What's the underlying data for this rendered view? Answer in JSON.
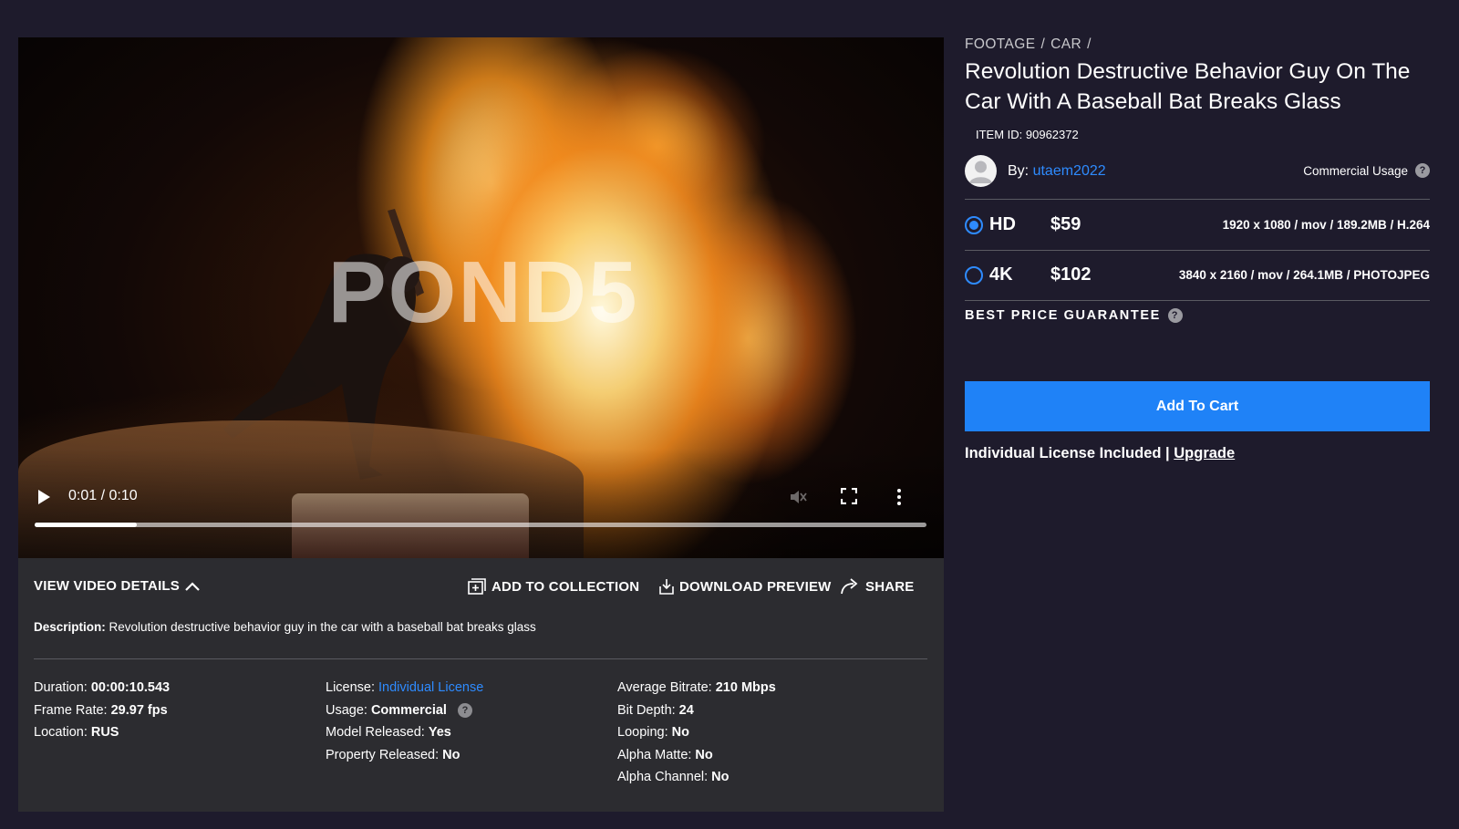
{
  "player": {
    "watermark": "POND5",
    "time": "0:01 / 0:10",
    "progress": 0.115
  },
  "details": {
    "tabs": {
      "view_details": "VIEW VIDEO DETAILS",
      "add_to_collection": "ADD TO COLLECTION",
      "download_preview": "DOWNLOAD PREVIEW",
      "share": "SHARE"
    },
    "description_label": "Description:",
    "description": "Revolution destructive behavior guy in the car with a baseball bat breaks glass",
    "col1": [
      {
        "label": "Duration:",
        "value": "00:00:10.543"
      },
      {
        "label": "Frame Rate:",
        "value": "29.97 fps"
      },
      {
        "label": "Location:",
        "value": "RUS"
      }
    ],
    "col2": [
      {
        "label": "License:",
        "value": "Individual License"
      },
      {
        "label": "Usage:",
        "value": "Commercial"
      },
      {
        "label": "Model Released:",
        "value": "Yes"
      },
      {
        "label": "Property Released:",
        "value": "No"
      }
    ],
    "col3": [
      {
        "label": "Average Bitrate:",
        "value": "210 Mbps"
      },
      {
        "label": "Bit Depth:",
        "value": "24"
      },
      {
        "label": "Looping:",
        "value": "No"
      },
      {
        "label": "Alpha Matte:",
        "value": "No"
      },
      {
        "label": "Alpha Channel:",
        "value": "No"
      }
    ]
  },
  "product": {
    "breadcrumb": [
      "FOOTAGE",
      "/",
      "CAR",
      "/"
    ],
    "title": "Revolution Destructive Behavior Guy On The Car With A Baseball Bat Breaks Glass",
    "item_id": "ITEM ID: 90962372",
    "by_label": "By:",
    "author": "utaem2022",
    "usage": "Commercial Usage",
    "options": [
      {
        "name": "HD",
        "price": "$59",
        "spec": "1920 x 1080 / mov / 189.2MB / H.264",
        "selected": true
      },
      {
        "name": "4K",
        "price": "$102",
        "spec": "3840 x 2160 / mov / 264.1MB / PHOTOJPEG",
        "selected": false
      }
    ],
    "guarantee": "BEST PRICE GUARANTEE",
    "cart_label": "Add To Cart",
    "license_text": "Individual License Included |",
    "upgrade_label": "Upgrade"
  },
  "colors": {
    "page_bg": "#1e1b2c",
    "panel_bg": "#2c2c30",
    "accent": "#1f82f7",
    "link": "#2e8bff"
  }
}
